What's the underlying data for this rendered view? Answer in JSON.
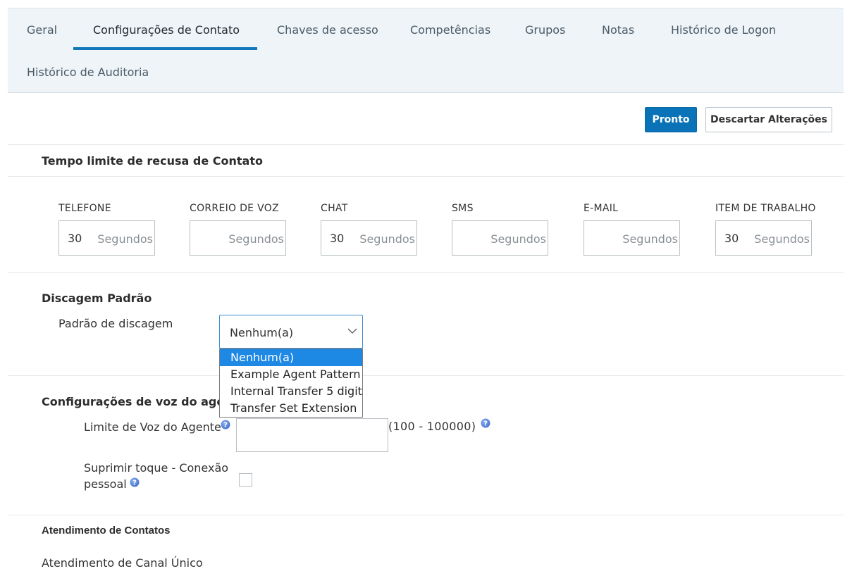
{
  "tabs": [
    {
      "label": "Geral"
    },
    {
      "label": "Configurações de Contato"
    },
    {
      "label": "Chaves de acesso"
    },
    {
      "label": "Competências"
    },
    {
      "label": "Grupos"
    },
    {
      "label": "Notas"
    },
    {
      "label": "Histórico de Logon"
    },
    {
      "label": "Histórico de Auditoria"
    }
  ],
  "actions": {
    "done_label": "Pronto",
    "discard_label": "Descartar Alterações"
  },
  "timeout_section": {
    "title": "Tempo limite de recusa de Contato",
    "fields": [
      {
        "label": "TELEFONE",
        "value": "30",
        "unit": "Segundos"
      },
      {
        "label": "CORREIO DE VOZ",
        "value": "",
        "unit": "Segundos"
      },
      {
        "label": "CHAT",
        "value": "30",
        "unit": "Segundos"
      },
      {
        "label": "SMS",
        "value": "",
        "unit": "Segundos"
      },
      {
        "label": "E-MAIL",
        "value": "",
        "unit": "Segundos"
      },
      {
        "label": "ITEM DE TRABALHO",
        "value": "30",
        "unit": "Segundos"
      }
    ]
  },
  "dial_section": {
    "title": "Discagem Padrão",
    "label": "Padrão de discagem",
    "selected": "Nenhum(a)",
    "options": [
      "Nenhum(a)",
      "Example Agent Pattern",
      "Internal Transfer 5 digit",
      "Transfer Set Extension"
    ]
  },
  "voice_section": {
    "title": "Configurações de voz do agente",
    "voice_limit_label": "Limite de Voz do Agente",
    "voice_limit_value": "",
    "voice_limit_range": "(100 - 100000)",
    "suppress_label_line1": "Suprimir toque - Conexão",
    "suppress_label_line2": "pessoal",
    "suppress_checked": false
  },
  "contact_handling": {
    "title": "Atendimento de Contatos",
    "single_channel_label": "Atendimento de Canal Único"
  },
  "colors": {
    "accent": "#0a73b7",
    "tab_bar_bg": "#eef4f7",
    "selected_option": "#1e88e5",
    "help_icon": "#3f6fd1"
  }
}
